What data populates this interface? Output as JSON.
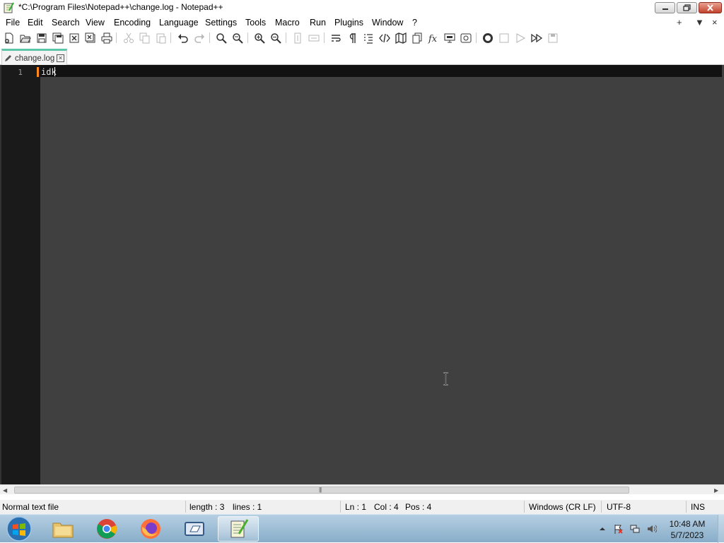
{
  "window": {
    "title": "*C:\\Program Files\\Notepad++\\change.log - Notepad++"
  },
  "menu": {
    "items": [
      "File",
      "Edit",
      "Search",
      "View",
      "Encoding",
      "Language",
      "Settings",
      "Tools",
      "Macro",
      "Run",
      "Plugins",
      "Window",
      "?"
    ],
    "right": [
      "+",
      "▼",
      "×"
    ]
  },
  "toolbar": {
    "icons": [
      "new-file-icon",
      "open-file-icon",
      "save-icon",
      "save-all-icon",
      "close-icon",
      "close-all-icon",
      "print-icon",
      "cut-icon",
      "copy-icon",
      "paste-icon",
      "undo-icon",
      "redo-icon",
      "find-icon",
      "replace-icon",
      "zoom-in-icon",
      "zoom-out-icon",
      "sync-vertical-icon",
      "sync-horizontal-icon",
      "word-wrap-icon",
      "show-all-chars-icon",
      "indent-guide-icon",
      "xml-tag-icon",
      "document-map-icon",
      "document-list-icon",
      "function-list-icon",
      "folder-as-workspace-icon",
      "monitoring-icon",
      "record-macro-icon",
      "stop-macro-icon",
      "play-macro-icon",
      "run-macro-multiple-icon",
      "save-macro-icon"
    ]
  },
  "tab": {
    "label": "change.log",
    "close": "×"
  },
  "editor": {
    "line_number": "1",
    "text": "idk"
  },
  "status": {
    "file_type": "Normal text file",
    "length": "length : 3",
    "lines": "lines : 1",
    "ln": "Ln : 1",
    "col": "Col : 4",
    "pos": "Pos : 4",
    "eol": "Windows (CR LF)",
    "encoding": "UTF-8",
    "mode": "INS"
  },
  "taskbar": {
    "apps": [
      "start-button",
      "file-explorer",
      "chrome",
      "firefox",
      "app-window",
      "notepad-plus-plus"
    ],
    "active_app": "notepad-plus-plus",
    "time": "10:48 AM",
    "date": "5/7/2023"
  },
  "colors": {
    "editor_bg": "#404040",
    "gutter_bg": "#1a1a1a",
    "current_line": "#121212",
    "tab_accent": "#5ec6a8",
    "change_marker": "#ff8a1f"
  }
}
